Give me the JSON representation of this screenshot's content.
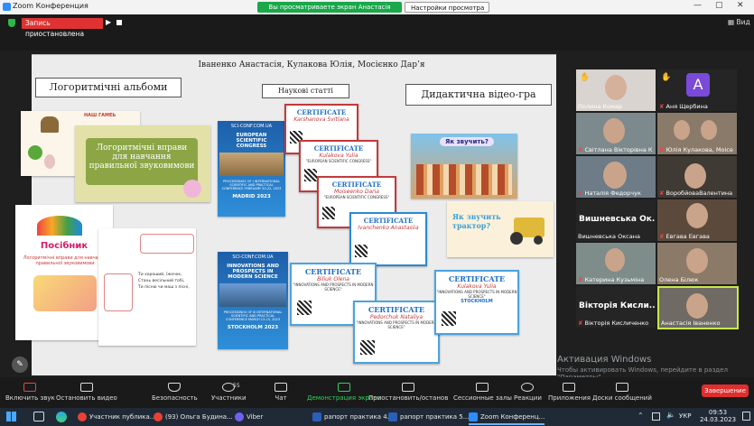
{
  "window": {
    "title": "Zoom Конференция",
    "share_banner": "Вы просматриваете экран Анастасія Іваненко",
    "view_settings": "Настройки просмотра",
    "recording": "Запись приостановлена",
    "view_label": "Вид"
  },
  "slide": {
    "authors": "Іваненко Анастасія, Кулакова Юлія, Мосієнко Дар’я",
    "section_left": "Логоритмічні альбоми",
    "section_mid": "Наукові статті",
    "section_right": "Дидактична відео-гра",
    "album_title": "Логоритмічні вправи для навчання правильної звуковимови",
    "small_page_title": "НАШ ГАМЕЬ",
    "guide_title": "Посібник",
    "guide_subtitle": "Логоритмічні вправи для навчання правильної звуковимови",
    "poem_lines": [
      "Ти хороший, їжачок,",
      "Стань весільний тобі,",
      "Ти пісню чи маш з пісні,"
    ],
    "site1": "SCI-CONF.COM.UA",
    "congress": "EUROPEAN SCIENTIFIC CONGRESS",
    "proc1": "PROCEEDINGS OF I INTERNATIONAL SCIENTIFIC AND PRACTICAL CONFERENCE FEBRUARY 20-22, 2023",
    "city1": "MADRID 2023",
    "site2": "SCI-CONF.COM.UA",
    "innov": "INNOVATIONS AND PROSPECTS IN MODERN SCIENCE",
    "proc2": "PROCEEDINGS OF III INTERNATIONAL SCIENTIFIC AND PRACTICAL CONFERENCE MARCH 13-15, 2023",
    "city2": "STOCKHOLM 2023",
    "cert_label": "CERTIFICATE",
    "cert_names": [
      "Karshanova Svitlana",
      "Kulakova Yulia",
      "Moiseenko Daria",
      "Ivanchenko Anastasiia",
      "Biliuk Olena",
      "Pedorchuk Nataliya",
      "Kulakova Yulia"
    ],
    "cert_event_a": "\"EUROPEAN SCIENTIFIC CONGRESS\"",
    "cert_event_b": "\"INNOVATIONS AND PROSPECTS IN MODERN SCIENCE\"",
    "cert_city": "STOCKHOLM",
    "game_q1": "Як звучить?",
    "game_q2": "Як звучить трактор?"
  },
  "participants": [
    {
      "name": "Полина Комар",
      "muted": false
    },
    {
      "name": "Аня Щербина",
      "muted": true,
      "avatar": "A"
    },
    {
      "name": "Світлана Вікторівна К",
      "muted": true
    },
    {
      "name": "Юлія Кулакова, Моісе",
      "muted": true
    },
    {
      "name": "Наталія Федорчук",
      "muted": true
    },
    {
      "name": "ВоробйоваВалентина",
      "muted": true
    },
    {
      "name": "Вишневська Оксана",
      "muted": false,
      "big": "Вишневська Ок..."
    },
    {
      "name": "Евгава Евгава",
      "muted": true
    },
    {
      "name": "Катерина Кузьміна",
      "muted": true
    },
    {
      "name": "Олена Білюк",
      "muted": false
    },
    {
      "name": "Вікторія Кисличенко",
      "muted": true,
      "big": "Вікторія Кисли..."
    },
    {
      "name": "Анастасія Іваненко",
      "muted": false
    }
  ],
  "toolbar": {
    "audio": "Включить звук",
    "video": "Остановить видео",
    "security": "Безопасность",
    "participants": "Участники",
    "participants_count": "55",
    "chat": "Чат",
    "share": "Демонстрация экрана",
    "pause": "Приостановить/остановить запись",
    "breakout": "Сессионные залы",
    "reactions": "Реакции",
    "apps": "Приложения",
    "whiteboard": "Доски сообщений",
    "end": "Завершение"
  },
  "watermark": {
    "line1": "Активация Windows",
    "line2": "Чтобы активировать Windows, перейдите в раздел \"Параметры\"."
  },
  "taskbar": {
    "items": [
      "Участник публика...",
      "(93) Ольга Будина...",
      "Viber",
      "рапорт практика 4...",
      "рапорт практика 5...",
      "Zoom Конференц..."
    ],
    "lang": "УКР",
    "time": "09:53",
    "date": "24.03.2023"
  },
  "colors": {
    "accent_green": "#1aa84a",
    "record_red": "#e03232",
    "end_red": "#e02d2d",
    "zoom_blue": "#2d8cff"
  }
}
